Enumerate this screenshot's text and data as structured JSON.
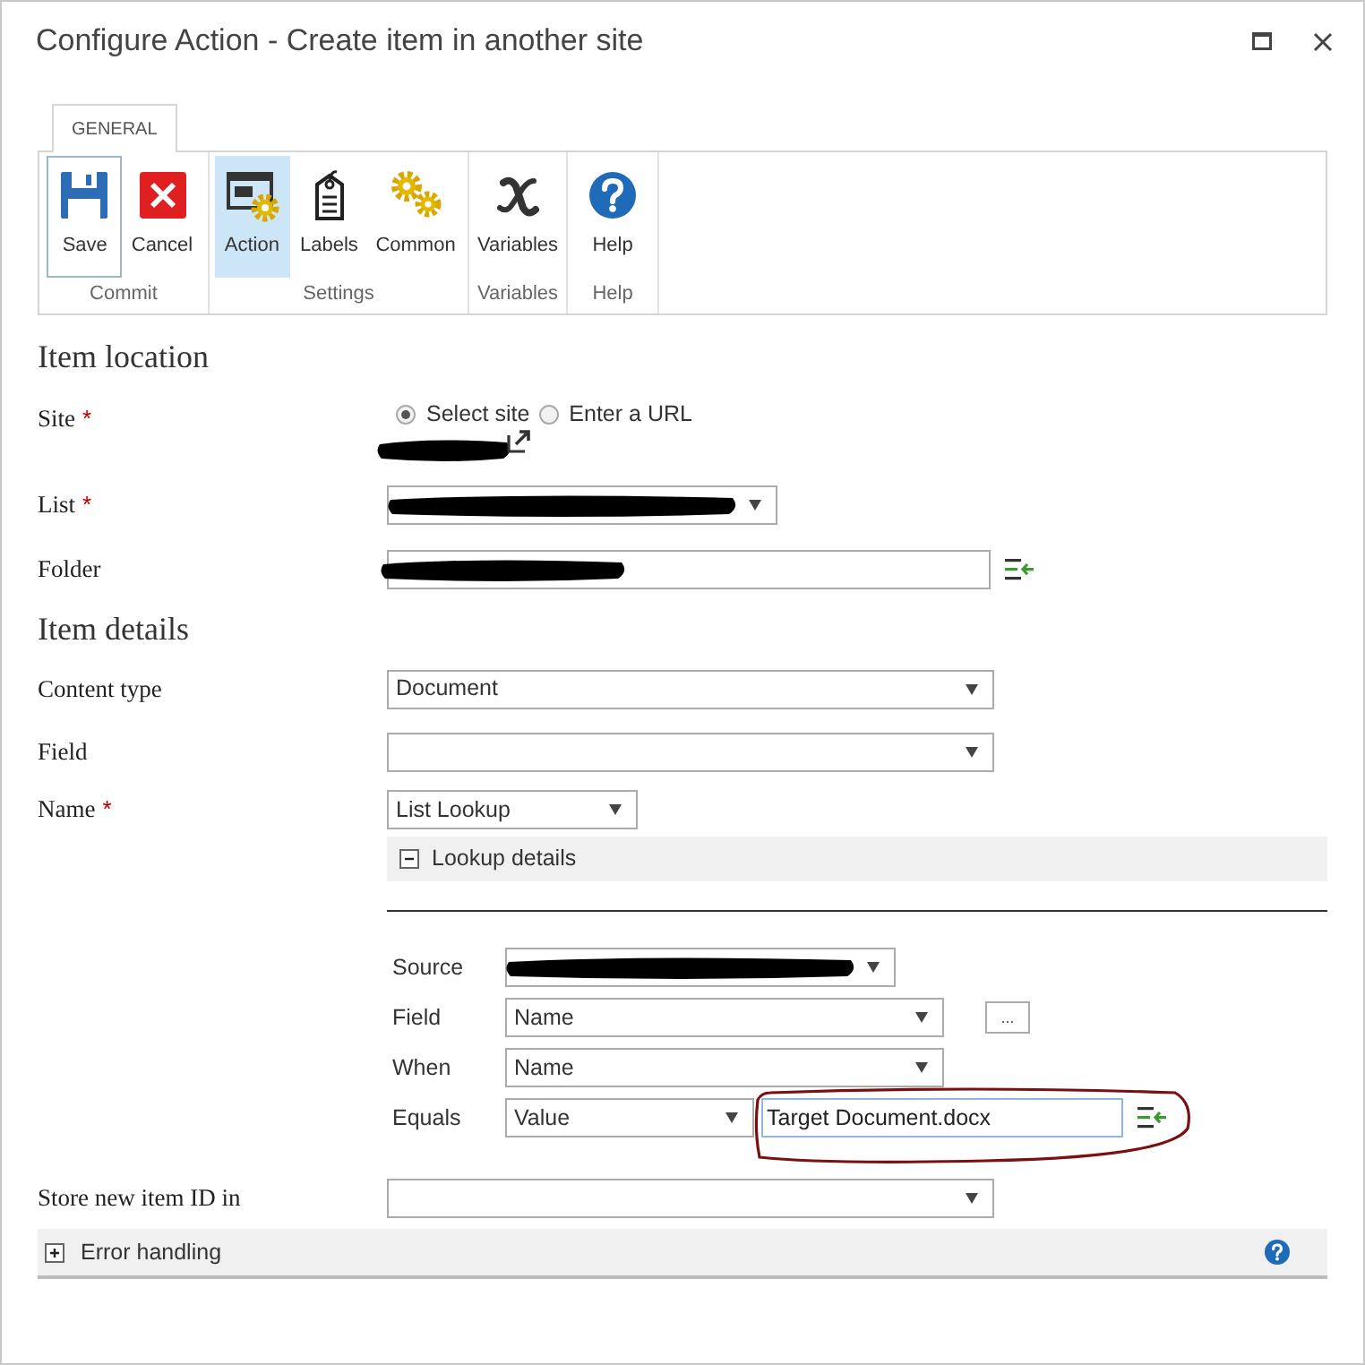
{
  "window": {
    "title": "Configure Action - Create item in another site"
  },
  "ribbon": {
    "tabs": [
      {
        "label": "GENERAL",
        "selected": true
      }
    ],
    "groups": [
      {
        "label": "Commit",
        "buttons": [
          {
            "label": "Save",
            "kind": "save",
            "selected": false,
            "focused": true
          },
          {
            "label": "Cancel",
            "kind": "cancel",
            "selected": false,
            "focused": false
          }
        ]
      },
      {
        "label": "Settings",
        "buttons": [
          {
            "label": "Action",
            "kind": "action",
            "selected": true,
            "focused": false
          },
          {
            "label": "Labels",
            "kind": "labels",
            "selected": false,
            "focused": false
          },
          {
            "label": "Common",
            "kind": "common",
            "selected": false,
            "focused": false
          }
        ]
      },
      {
        "label": "Variables",
        "buttons": [
          {
            "label": "Variables",
            "kind": "variables",
            "selected": false,
            "focused": false
          }
        ]
      },
      {
        "label": "Help",
        "buttons": [
          {
            "label": "Help",
            "kind": "help",
            "selected": false,
            "focused": false
          }
        ]
      }
    ]
  },
  "item_location": {
    "heading": "Item location",
    "site": {
      "label": "Site",
      "required_mark": "*",
      "options": [
        {
          "label": "Select site",
          "selected": true
        },
        {
          "label": "Enter a URL",
          "selected": false
        }
      ],
      "redacted": true
    },
    "list": {
      "label": "List",
      "required_mark": "*",
      "redacted": true
    },
    "folder": {
      "label": "Folder",
      "redacted": true
    }
  },
  "item_details": {
    "heading": "Item details",
    "fields": [
      {
        "label": "Content type",
        "value": "Document"
      },
      {
        "label": "Field"
      },
      {
        "label": "Name",
        "required_mark": "*",
        "value": "List Lookup"
      }
    ],
    "lookup": {
      "title": "Lookup details",
      "expanded": true,
      "rows": [
        {
          "kind": "select",
          "label": "Source",
          "redacted": true
        },
        {
          "kind": "select",
          "label": "Field",
          "value": "Name",
          "picker_label": "..."
        },
        {
          "kind": "select",
          "label": "When",
          "value": "Name"
        },
        {
          "kind": "select_input",
          "label": "Equals",
          "value": "Value",
          "text": "Target Document.docx",
          "annotated": true
        }
      ]
    },
    "store": {
      "label": "Store new item ID in"
    }
  },
  "error_handling": {
    "title": "Error handling",
    "expanded": false
  }
}
